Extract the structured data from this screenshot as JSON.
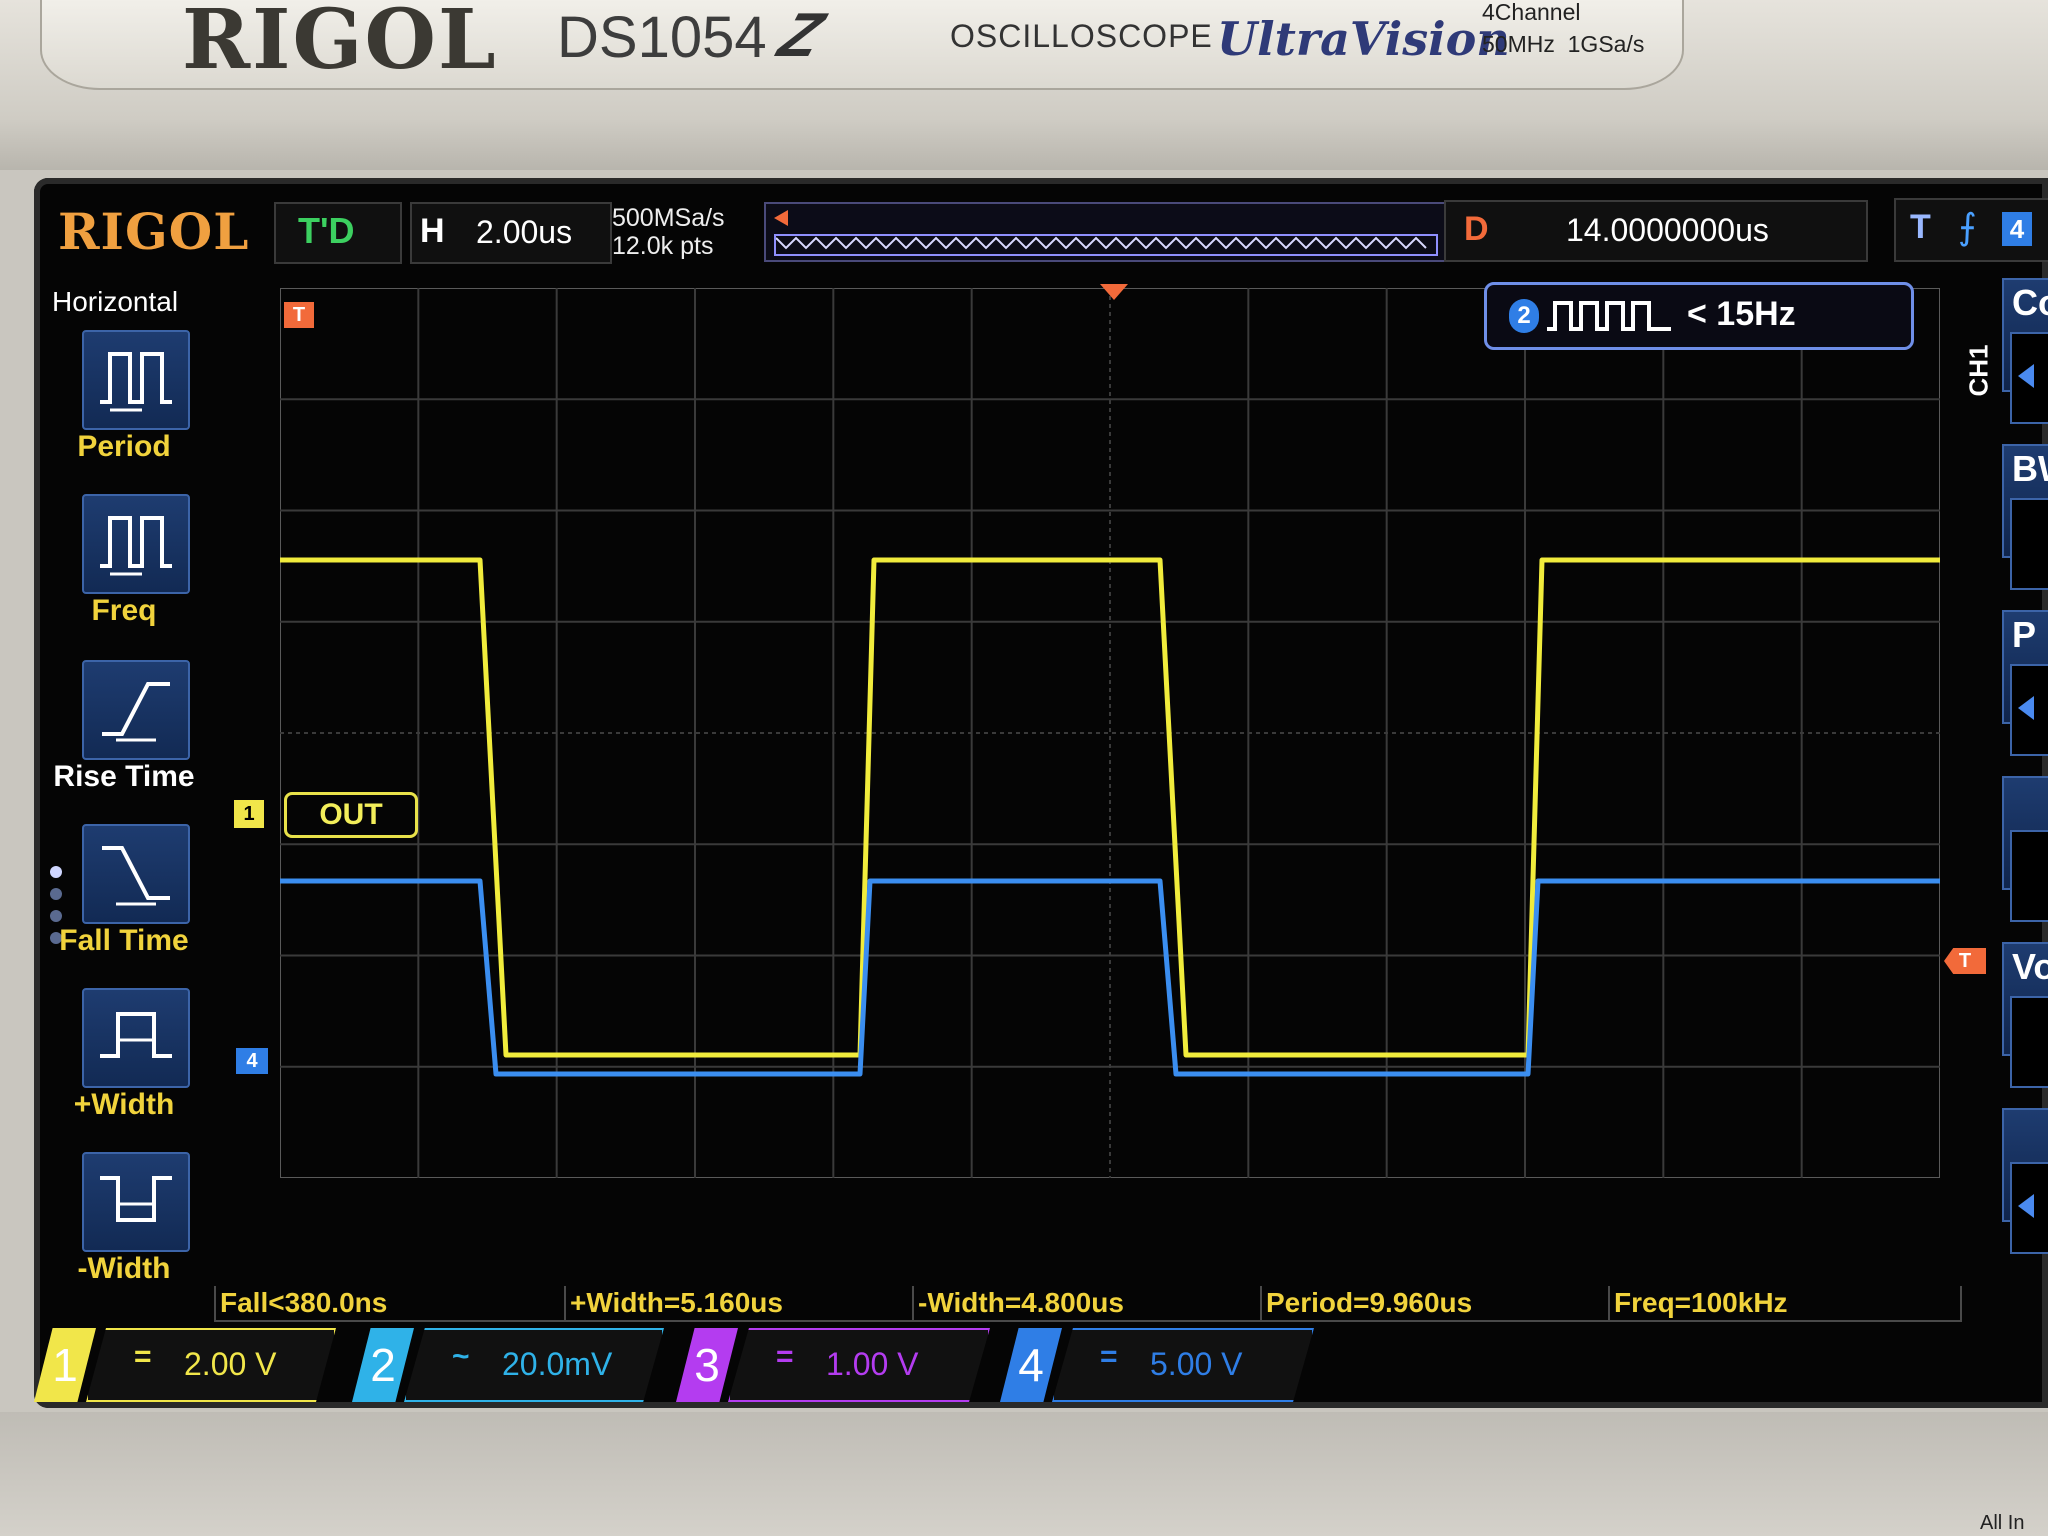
{
  "device": {
    "brand": "RIGOL",
    "model": "DS1054",
    "model_suffix": "Z",
    "type_label": "OSCILLOSCOPE",
    "series_logo": "UltraVision",
    "channels_spec": "4Channel",
    "bandwidth_spec": "50MHz",
    "sample_spec": "1GSa/s",
    "corner_text": "All In"
  },
  "topbar": {
    "logo": "RIGOL",
    "run_status": "T'D",
    "horizontal_label": "H",
    "timebase": "2.00us",
    "sample_rate": "500MSa/s",
    "memory_depth": "12.0k pts",
    "delay_label": "D",
    "delay_value": "14.0000000us",
    "trigger_label": "T",
    "trigger_edge_icon": "rising-edge-icon",
    "trigger_source": "4"
  },
  "left_menu": {
    "title": "Horizontal",
    "items": [
      {
        "label": "Period",
        "icon": "period-icon"
      },
      {
        "label": "Freq",
        "icon": "freq-icon"
      },
      {
        "label": "Rise Time",
        "icon": "rise-time-icon"
      },
      {
        "label": "Fall Time",
        "icon": "fall-time-icon"
      },
      {
        "label": "+Width",
        "icon": "positive-width-icon"
      },
      {
        "label": "-Width",
        "icon": "negative-width-icon"
      }
    ]
  },
  "waveform": {
    "rate_channel": "2",
    "rate_text": "< 15Hz",
    "ch1_label": "OUT",
    "ch1_marker": "1",
    "ch4_marker": "4",
    "trigger_pos_marker": "T",
    "trigger_level_marker": "T",
    "ch1_color": "#f1ec3c",
    "ch4_color": "#3b8ef0"
  },
  "right_panel": {
    "channel_label": "CH1",
    "menu_letters": [
      "Co",
      "BW",
      "P",
      "",
      "Vo",
      "",
      ""
    ]
  },
  "measurements": [
    "Fall<380.0ns",
    "+Width=5.160us",
    "-Width=4.800us",
    "Period=9.960us",
    "Freq=100kHz"
  ],
  "channel_scales": [
    {
      "num": "1",
      "coupling": "=",
      "scale": "2.00 V",
      "color": "#f1e64a"
    },
    {
      "num": "2",
      "coupling": "~",
      "scale": "20.0mV",
      "color": "#2fb2e8"
    },
    {
      "num": "3",
      "coupling": "=",
      "scale": "1.00 V",
      "color": "#b43cf0"
    },
    {
      "num": "4",
      "coupling": "=",
      "scale": "5.00 V",
      "color": "#2f7ee6"
    }
  ]
}
